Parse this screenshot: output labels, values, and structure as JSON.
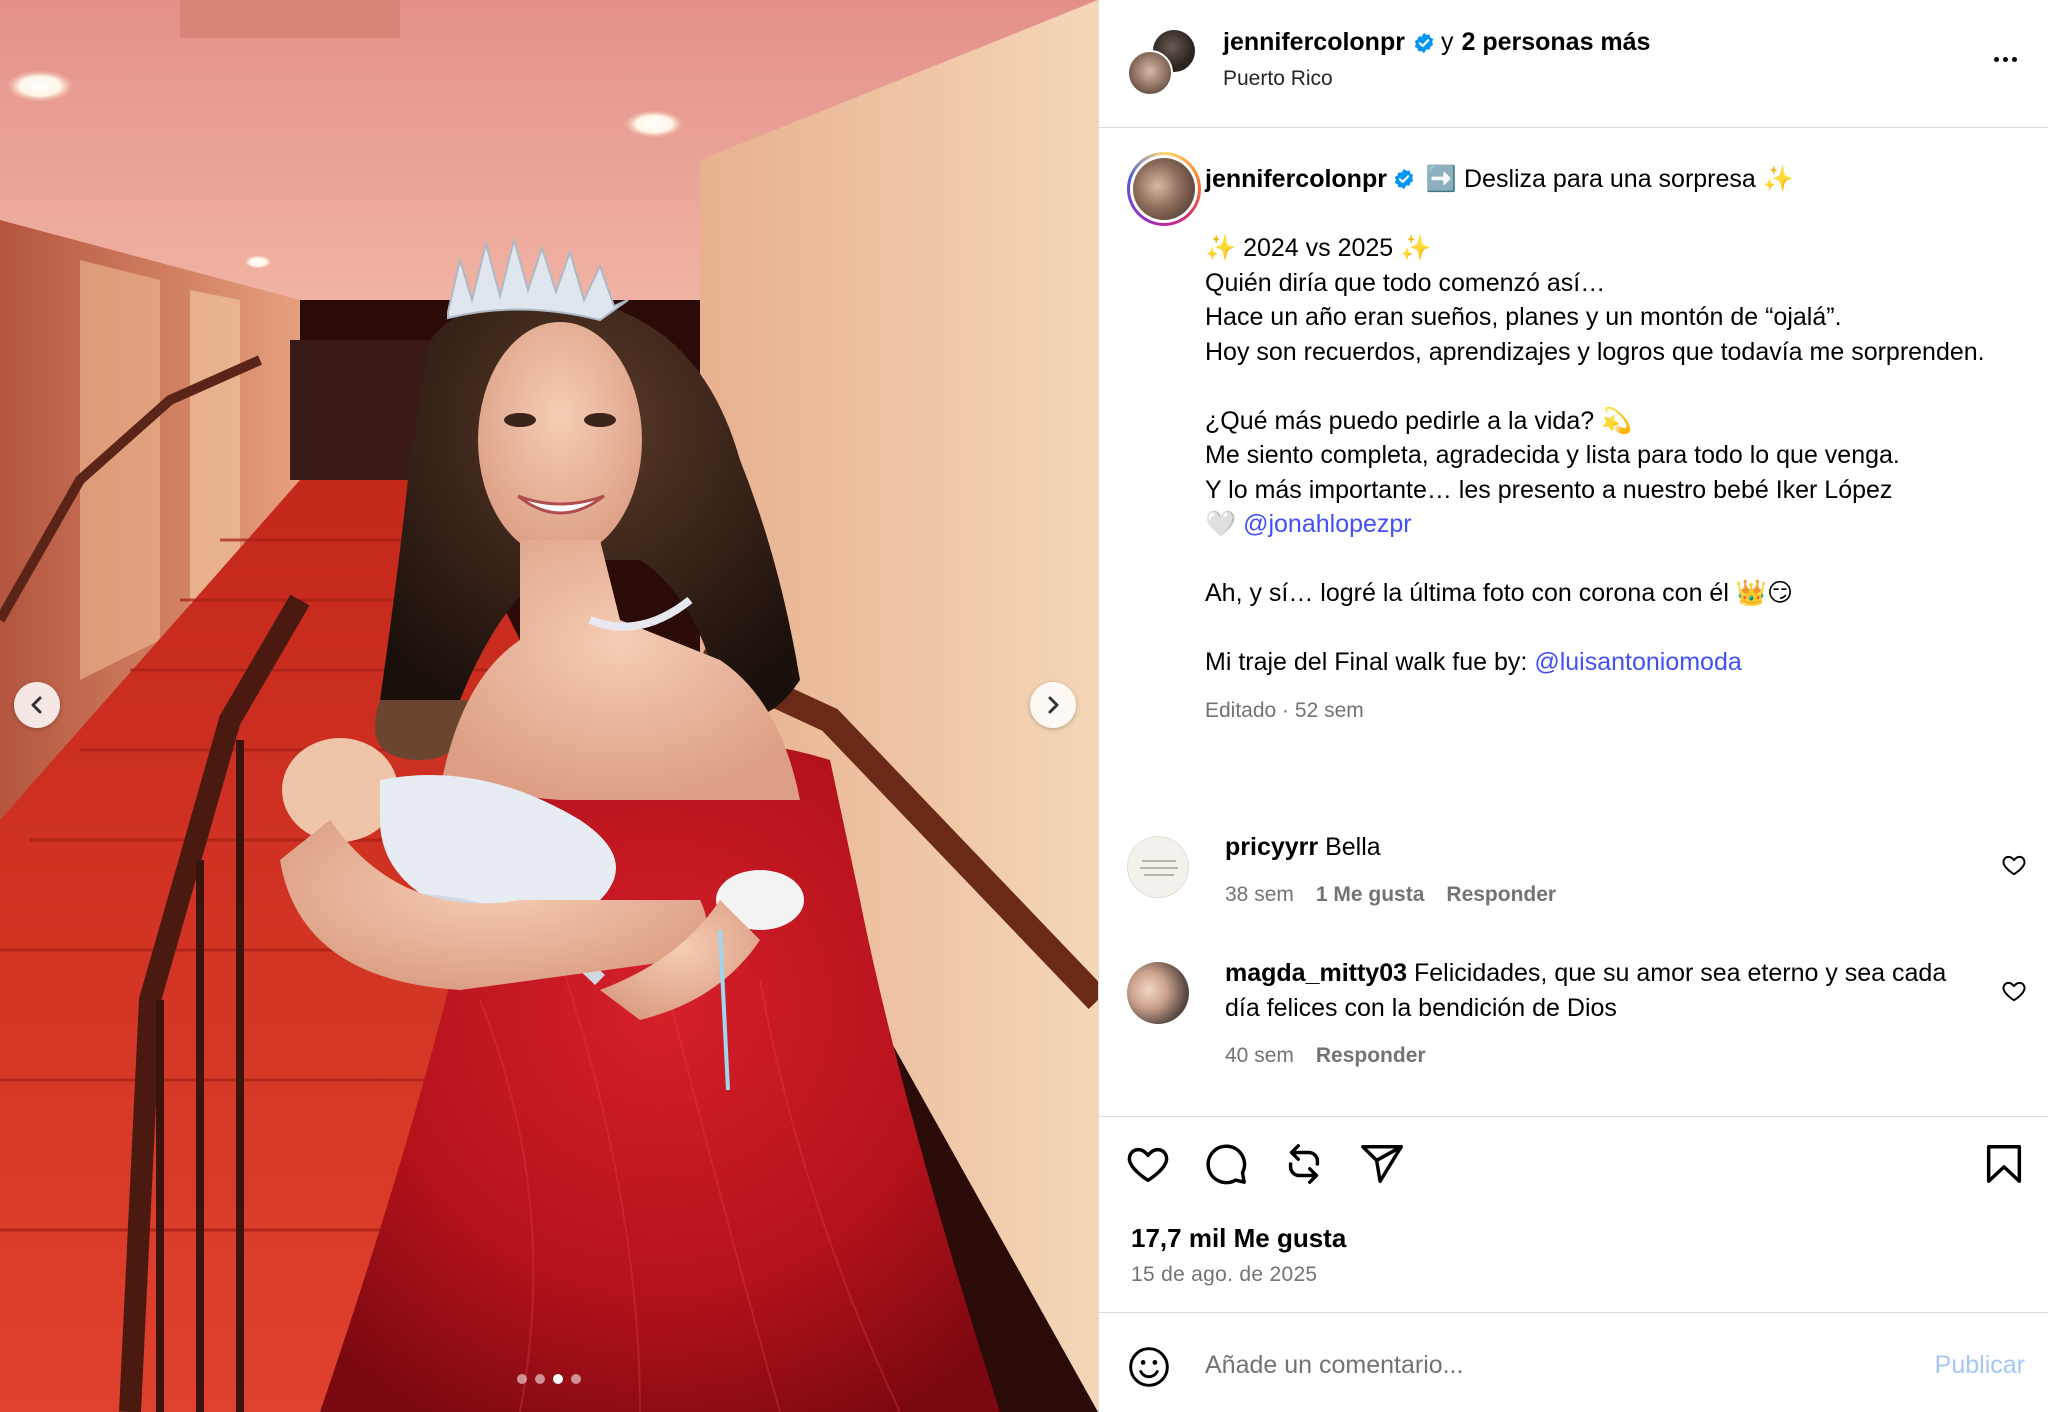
{
  "header": {
    "username": "jennifercolonpr",
    "connector": "y",
    "others": "2 personas más",
    "location": "Puerto Rico"
  },
  "caption": {
    "username": "jennifercolonpr",
    "lines": [
      "➡️ Desliza para una sorpresa ✨",
      "",
      "✨ 2024 vs 2025 ✨",
      "Quién diría que todo comenzó así…",
      "Hace un año eran sueños, planes y un montón de “ojalá”.",
      "Hoy son recuerdos, aprendizajes y logros que todavía me sorprenden.",
      "",
      "¿Qué más puedo pedirle a la vida? 💫",
      "Me siento completa, agradecida y lista para todo lo que venga.",
      "Y lo más importante… les presento a nuestro bebé Iker López",
      "🤍",
      "",
      "Ah, y sí… logré la última foto con corona con él 👑😏",
      "",
      "Mi traje del Final walk fue by:"
    ],
    "mention_1": "@jonahlopezpr",
    "mention_2": "@luisantoniomoda",
    "meta": "Editado · 52 sem"
  },
  "comments": [
    {
      "username": "pricyyrr",
      "text": "Bella",
      "time": "38 sem",
      "likes": "1 Me gusta",
      "reply": "Responder"
    },
    {
      "username": "magda_mitty03",
      "text": "Felicidades, que su amor sea eterno y sea cada día felices con la bendición de Dios",
      "time": "40 sem",
      "reply": "Responder"
    }
  ],
  "actions": {
    "likes": "17,7 mil Me gusta",
    "date": "15 de ago. de 2025"
  },
  "composer": {
    "placeholder": "Añade un comentario...",
    "publish": "Publicar"
  },
  "carousel": {
    "slide_count": 4,
    "active_index": 2
  },
  "colors": {
    "mention": "#4150f7",
    "muted": "#737373",
    "verified": "#0095f6",
    "publish_disabled": "#a5c7f5",
    "divider": "#dbdbdb"
  },
  "icons": [
    "chevron-left-icon",
    "chevron-right-icon",
    "more-icon",
    "verified-icon",
    "heart-icon",
    "comment-icon",
    "repost-icon",
    "share-icon",
    "bookmark-icon",
    "emoji-icon"
  ]
}
